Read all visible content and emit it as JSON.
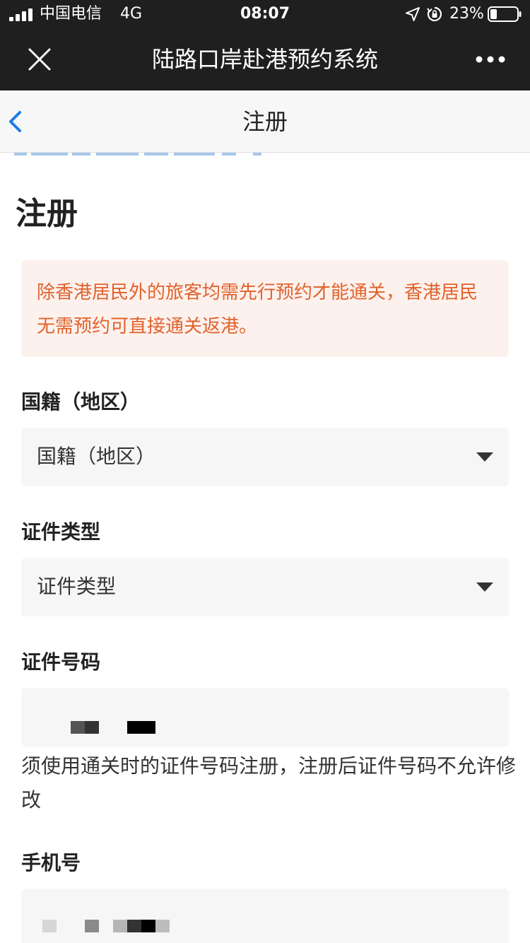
{
  "status_bar": {
    "carrier": "中国电信",
    "network": "4G",
    "time": "08:07",
    "battery_percent": "23%",
    "icons": [
      "signal-icon",
      "location-icon",
      "rotation-lock-icon",
      "battery-icon"
    ]
  },
  "title_bar": {
    "title": "陆路口岸赴港预约系统",
    "icons": [
      "close-icon",
      "more-icon"
    ]
  },
  "nav": {
    "title": "注册",
    "icons": [
      "back-chevron-icon"
    ]
  },
  "page": {
    "heading": "注册",
    "notice": "除香港居民外的旅客均需先行预约才能通关，香港居民无需预约可直接通关返港。"
  },
  "form": {
    "nationality": {
      "label": "国籍（地区）",
      "placeholder": "国籍（地区）"
    },
    "id_type": {
      "label": "证件类型",
      "placeholder": "证件类型"
    },
    "id_number": {
      "label": "证件号码",
      "hint": "须使用通关时的证件号码注册，注册后证件号码不允许修改"
    },
    "phone": {
      "label": "手机号"
    }
  },
  "colors": {
    "bar_bg": "#1f1f1f",
    "nav_bg": "#f7f7f7",
    "accent_blue": "#1a7ce8",
    "notice_bg": "#fdf1ed",
    "notice_text": "#e0622c",
    "field_bg": "#f6f6f6"
  }
}
